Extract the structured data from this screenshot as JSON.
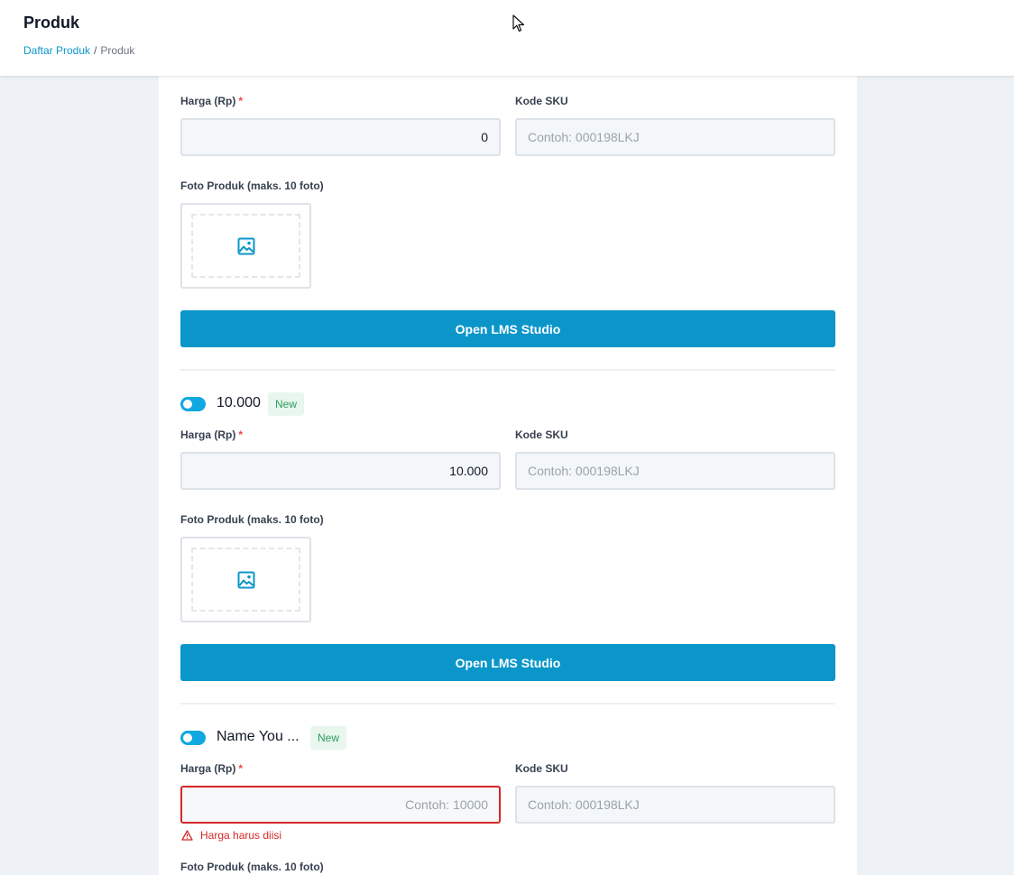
{
  "header": {
    "title": "Produk",
    "breadcrumb": {
      "link": "Daftar Produk",
      "separator": "/",
      "current": "Produk"
    }
  },
  "labels": {
    "price": "Harga (Rp)",
    "required_mark": "*",
    "sku": "Kode SKU",
    "photos": "Foto Produk (maks. 10 foto)",
    "open_studio": "Open LMS Studio",
    "new_badge": "New"
  },
  "variants": [
    {
      "price_value": "0",
      "sku_placeholder": "Contoh: 000198LKJ"
    },
    {
      "name": "10.000",
      "price_value": "10.000",
      "sku_placeholder": "Contoh: 000198LKJ"
    },
    {
      "name": "Name You ...",
      "price_value": "",
      "price_placeholder": "Contoh: 10000",
      "sku_placeholder": "Contoh: 000198LKJ",
      "error": "Harga harus diisi"
    }
  ],
  "icons": {
    "photo": "image-icon",
    "error": "warning-triangle-icon",
    "cursor": "mouse-cursor-icon"
  },
  "colors": {
    "primary": "#0b96c9",
    "toggle": "#10a8e0",
    "error": "#d62828",
    "badge_text": "#2e9c5a",
    "badge_bg": "#e8f6ee"
  }
}
